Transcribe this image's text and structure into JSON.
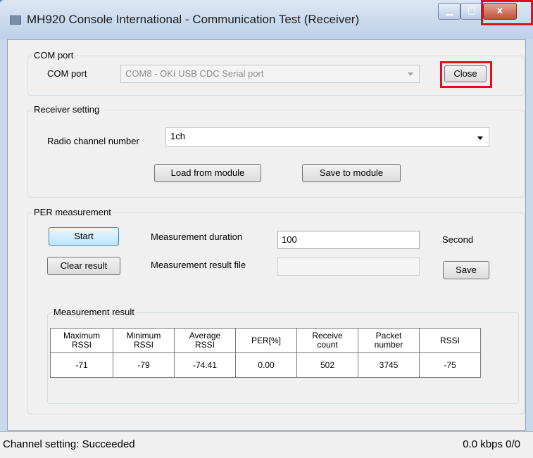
{
  "window": {
    "title": "MH920 Console International -  Communication Test (Receiver)",
    "close_glyph": "x"
  },
  "com_port": {
    "group_label": "COM port",
    "field_label": "COM port",
    "selected": "COM8 - OKI USB CDC Serial port",
    "close_button": "Close"
  },
  "receiver": {
    "group_label": "Receiver setting",
    "channel_label": "Radio channel number",
    "channel_value": "1ch",
    "load_button": "Load from module",
    "save_button": "Save to module"
  },
  "per": {
    "group_label": "PER measurement",
    "start_button": "Start",
    "clear_button": "Clear result",
    "duration_label": "Measurement duration",
    "duration_value": "100",
    "duration_unit": "Second",
    "file_label": "Measurement result file",
    "file_value": "",
    "save_button": "Save"
  },
  "result": {
    "group_label": "Measurement result",
    "headers": [
      [
        "Maximum",
        "RSSI"
      ],
      [
        "Minimum",
        "RSSI"
      ],
      [
        "Average",
        "RSSI"
      ],
      [
        "PER[%]"
      ],
      [
        "Receive",
        "count"
      ],
      [
        "Packet",
        "number"
      ],
      [
        "RSSI"
      ]
    ],
    "values": [
      "-71",
      "-79",
      "-74.41",
      "0.00",
      "502",
      "3745",
      "-75"
    ]
  },
  "status": {
    "message": "Channel setting: Succeeded",
    "rate": "0.0 kbps  0/0"
  }
}
